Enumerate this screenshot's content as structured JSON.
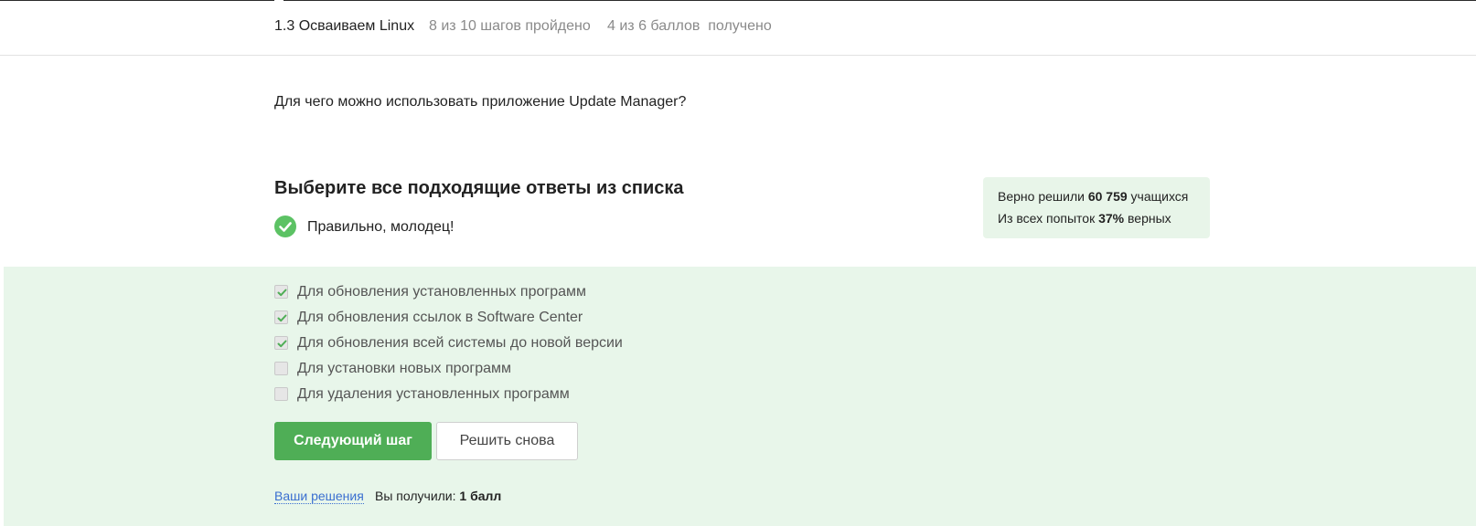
{
  "header": {
    "lesson_title": "1.3 Осваиваем Linux",
    "steps": "8 из 10 шагов пройдено",
    "points": "4 из 6 баллов  получено"
  },
  "question": {
    "text": "Для чего можно использовать приложение Update Manager?"
  },
  "instruction": "Выберите все подходящие ответы из списка",
  "feedback": {
    "icon": "check-circle-icon",
    "text": "Правильно, молодец!",
    "color": "#5cc264"
  },
  "stats": {
    "solved_prefix": "Верно решили",
    "solved_count": "60 759",
    "solved_suffix": "учащихся",
    "attempts_prefix": "Из всех попыток",
    "attempts_percent": "37%",
    "attempts_suffix": "верных"
  },
  "options": [
    {
      "label": "Для обновления установленных программ",
      "checked": true
    },
    {
      "label": "Для обновления ссылок в Software Center",
      "checked": true
    },
    {
      "label": "Для обновления всей системы до новой версии",
      "checked": true
    },
    {
      "label": "Для установки новых программ",
      "checked": false
    },
    {
      "label": "Для удаления установленных программ",
      "checked": false
    }
  ],
  "buttons": {
    "next": "Следующий шаг",
    "retry": "Решить снова"
  },
  "footer": {
    "solutions_link": "Ваши решения",
    "score_prefix": "Вы получили:",
    "score_value": "1 балл"
  },
  "colors": {
    "accent_green": "#4fae56",
    "answer_bg": "#e8f6ea",
    "stats_bg": "#e8f5e9",
    "link_blue": "#3a6fd0"
  }
}
